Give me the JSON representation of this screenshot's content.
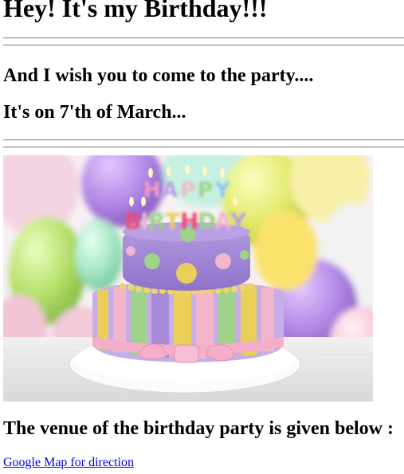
{
  "heading": "Hey! It's my Birthday!!!",
  "invite_text": "And I wish you to come to the party....",
  "date_text": "It's on 7'th of March...",
  "image": {
    "cake_lettering_top": "HAPPY",
    "cake_lettering_bottom": "BIRTHDAY",
    "balloon_colors": [
      "#b58ce8",
      "#d8e86a",
      "#f4c2d4",
      "#cbe88c",
      "#f7df6a",
      "#a7e6c6"
    ],
    "cake_colors": [
      "#a98ad8",
      "#f2b6cc",
      "#e9cf5a",
      "#9fd28a"
    ]
  },
  "venue_heading": "The venue of the birthday party is given below :",
  "map_link_text": "Google Map for direction"
}
